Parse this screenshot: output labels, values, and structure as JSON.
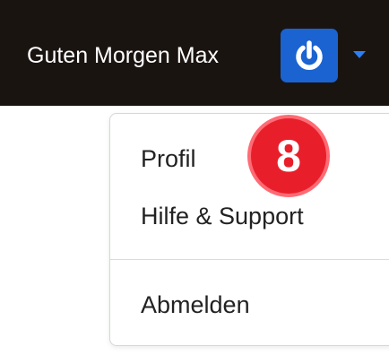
{
  "header": {
    "greeting": "Guten Morgen Max",
    "power_icon": "power-icon",
    "dropdown_icon": "chevron-down-icon"
  },
  "dropdown": {
    "items": [
      {
        "label": "Profil"
      },
      {
        "label": "Hilfe & Support"
      },
      {
        "label": "Abmelden"
      }
    ]
  },
  "annotation": {
    "step_number": "8"
  },
  "colors": {
    "header_background": "#1a1411",
    "power_button_background": "#1a63d1",
    "dropdown_caret": "#2b7ef4",
    "step_badge": "#e81f2b"
  }
}
